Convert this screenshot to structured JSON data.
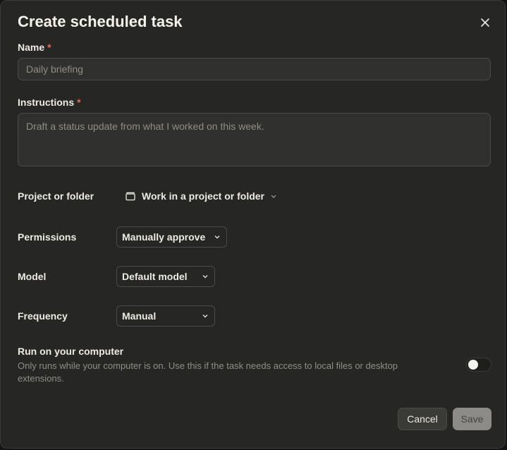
{
  "dialog": {
    "title": "Create scheduled task",
    "close_icon": "close-icon"
  },
  "name": {
    "label": "Name",
    "required_mark": "*",
    "value": "",
    "placeholder": "Daily briefing"
  },
  "instructions": {
    "label": "Instructions",
    "required_mark": "*",
    "value": "",
    "placeholder": "Draft a status update from what I worked on this week."
  },
  "project": {
    "label": "Project or folder",
    "value": "Work in a project or folder",
    "icon": "folder-icon"
  },
  "permissions": {
    "label": "Permissions",
    "value": "Manually approve"
  },
  "model": {
    "label": "Model",
    "value": "Default model"
  },
  "frequency": {
    "label": "Frequency",
    "value": "Manual"
  },
  "run_on_computer": {
    "title": "Run on your computer",
    "description": "Only runs while your computer is on. Use this if the task needs access to local files or desktop extensions.",
    "enabled": false
  },
  "footer": {
    "cancel_label": "Cancel",
    "save_label": "Save"
  },
  "colors": {
    "background": "#262624",
    "required": "#E06A5C",
    "save_button": "#8c8b87"
  }
}
